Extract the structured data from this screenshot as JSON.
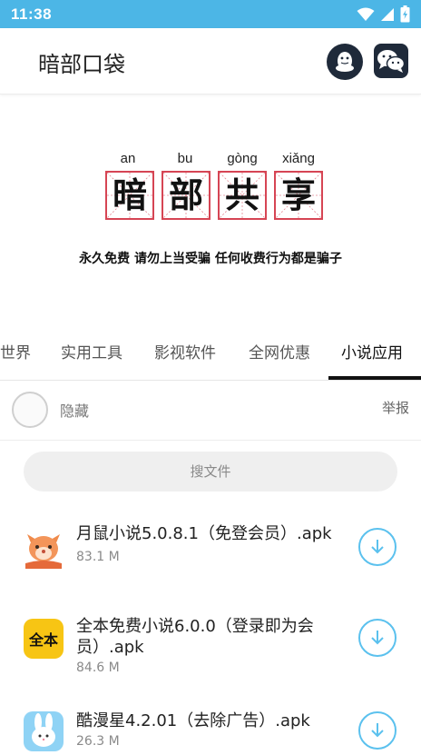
{
  "status_bar": {
    "time": "11:38",
    "icons": [
      "wifi-icon",
      "signal-icon",
      "battery-icon"
    ]
  },
  "app_bar": {
    "title": "暗部口袋",
    "actions": [
      "qq-icon",
      "wechat-icon"
    ]
  },
  "banner": {
    "pinyin": [
      "an",
      "bu",
      "gòng",
      "xiǎng"
    ],
    "chars": [
      "暗",
      "部",
      "共",
      "享"
    ],
    "slogan": "永久免费 请勿上当受骗 任何收费行为都是骗子"
  },
  "tabs": [
    {
      "label": "世界"
    },
    {
      "label": "实用工具"
    },
    {
      "label": "影视软件"
    },
    {
      "label": "全网优惠"
    },
    {
      "label": "小说应用",
      "active": true
    }
  ],
  "uploader": {
    "hide_label": "隐藏",
    "report_label": "举报"
  },
  "search": {
    "placeholder": "搜文件"
  },
  "files": [
    {
      "name": "月鼠小说5.0.8.1（免登会员）.apk",
      "size": "83.1 M",
      "icon": "mouse-novel-icon"
    },
    {
      "name": "全本免费小说6.0.0（登录即为会员）.apk",
      "size": "84.6 M",
      "icon": "quanben-icon",
      "icon_text": "全本"
    },
    {
      "name": "酷漫星4.2.01（去除广告）.apk",
      "size": "26.3 M",
      "icon": "rabbit-icon"
    }
  ],
  "colors": {
    "accent": "#4cb6e6",
    "grid_red": "#d64554",
    "dark_icon_bg": "#1f2a3a",
    "download_blue": "#5bc1ee"
  }
}
